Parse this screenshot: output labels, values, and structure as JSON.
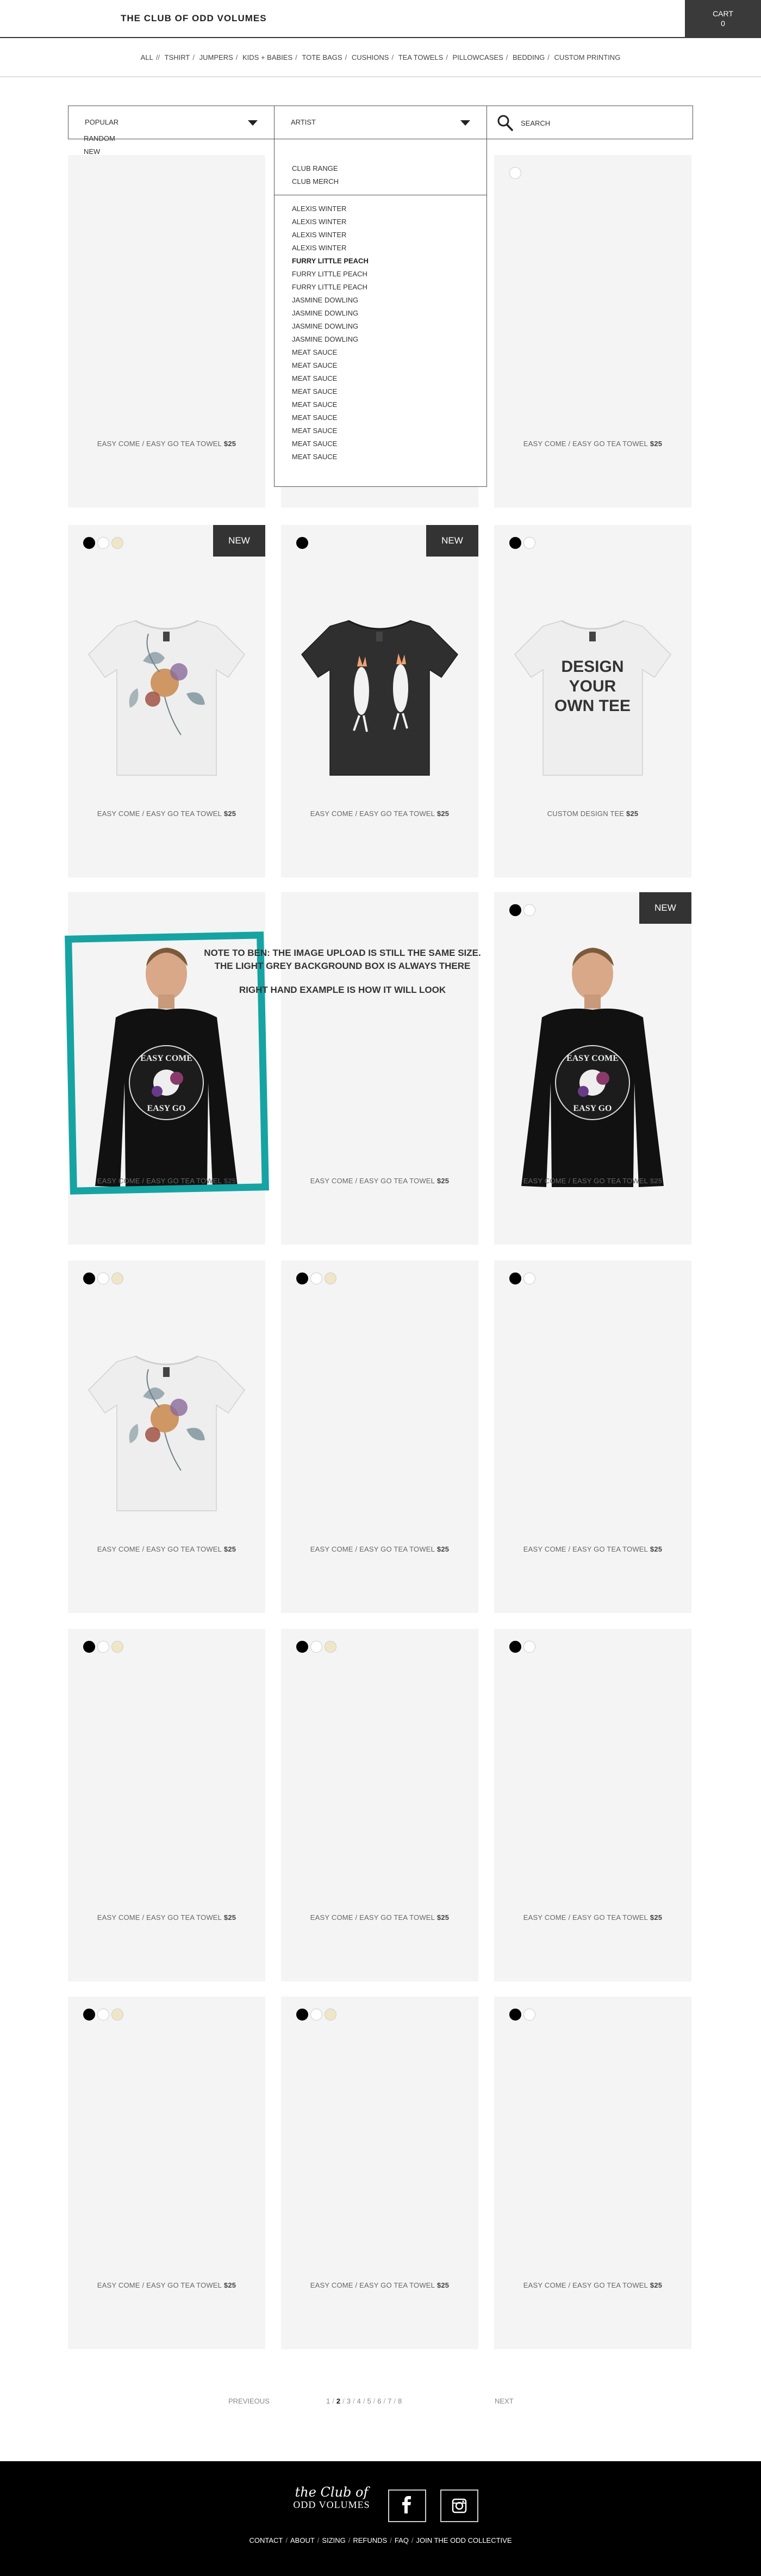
{
  "header": {
    "logo": "THE CLUB OF ODD VOLUMES",
    "cart_label": "CART",
    "cart_count": "0"
  },
  "nav": {
    "items": [
      "ALL",
      "TSHIRT",
      "JUMPERS",
      "KIDS + BABIES",
      "TOTE BAGS",
      "CUSHIONS",
      "TEA TOWELS",
      "PILLOWCASES",
      "BEDDING",
      "CUSTOM PRINTING"
    ],
    "separators": [
      "//",
      "/",
      "/",
      "/",
      "/",
      "/",
      "/",
      "/",
      "/"
    ]
  },
  "filters": {
    "sort": {
      "selected": "POPULAR",
      "options": [
        "RANDOM",
        "NEW"
      ]
    },
    "artist": {
      "selected": "ARTIST",
      "groups": [
        "CLUB RANGE",
        "CLUB MERCH"
      ],
      "artists": [
        "ALEXIS WINTER",
        "ALEXIS WINTER",
        "ALEXIS WINTER",
        "ALEXIS WINTER",
        "FURRY LITTLE PEACH",
        "FURRY LITTLE PEACH",
        "FURRY LITTLE PEACH",
        "JASMINE DOWLING",
        "JASMINE DOWLING",
        "JASMINE DOWLING",
        "JASMINE DOWLING",
        "MEAT SAUCE",
        "MEAT SAUCE",
        "MEAT SAUCE",
        "MEAT SAUCE",
        "MEAT SAUCE",
        "MEAT SAUCE",
        "MEAT SAUCE",
        "MEAT SAUCE",
        "MEAT SAUCE"
      ],
      "active": "FURRY LITTLE PEACH"
    },
    "search": {
      "placeholder": "SEARCH"
    }
  },
  "colors": {
    "black": "#000000",
    "white": "#ffffff",
    "cream": "#efe6c8",
    "card_bg": "#f4f4f4",
    "badge_bg": "#333333",
    "teal": "#16a3a3",
    "cart_bg": "#3a3a3a",
    "tee_white": "#eeeeee",
    "tee_black": "#2f2f2f"
  },
  "products": [
    {
      "name": "EASY COME / EASY GO TEA TOWEL",
      "price": "$25",
      "swatches": [],
      "badge": "",
      "image": ""
    },
    {
      "name": "",
      "price": "",
      "swatches": [],
      "badge": "",
      "image": ""
    },
    {
      "name": "EASY COME / EASY GO TEA TOWEL",
      "price": "$25",
      "swatches": [
        "white"
      ],
      "badge": "",
      "image": ""
    },
    {
      "name": "EASY COME / EASY GO TEA TOWEL",
      "price": "$25",
      "swatches": [
        "black",
        "white",
        "cream"
      ],
      "badge": "NEW",
      "image": "white-floral-tee"
    },
    {
      "name": "EASY COME / EASY GO TEA TOWEL",
      "price": "$25",
      "swatches": [
        "black"
      ],
      "badge": "NEW",
      "image": "black-cockatoo-tee"
    },
    {
      "name": "CUSTOM DESIGN TEE",
      "price": "$25",
      "swatches": [
        "black",
        "white"
      ],
      "badge": "",
      "image": "design-your-own-tee",
      "image_text": [
        "DESIGN",
        "YOUR",
        "OWN TEE"
      ]
    },
    {
      "name": "EASY COME / EASY GO TEA TOWEL",
      "price": "$25",
      "swatches": [],
      "badge": "",
      "image": "model-black-sweater"
    },
    {
      "name": "EASY COME / EASY GO TEA TOWEL",
      "price": "$25",
      "swatches": [],
      "badge": "",
      "image": ""
    },
    {
      "name": "EASY COME / EASY GO TEA TOWEL",
      "price": "$25",
      "swatches": [
        "black",
        "white"
      ],
      "badge": "NEW",
      "image": "model-black-sweater"
    },
    {
      "name": "EASY COME / EASY GO TEA TOWEL",
      "price": "$25",
      "swatches": [
        "black",
        "white",
        "cream"
      ],
      "badge": "",
      "image": "white-floral-tee"
    },
    {
      "name": "EASY COME / EASY GO TEA TOWEL",
      "price": "$25",
      "swatches": [
        "black",
        "white",
        "cream"
      ],
      "badge": "",
      "image": ""
    },
    {
      "name": "EASY COME / EASY GO TEA TOWEL",
      "price": "$25",
      "swatches": [
        "black",
        "white"
      ],
      "badge": "",
      "image": ""
    },
    {
      "name": "EASY COME / EASY GO TEA TOWEL",
      "price": "$25",
      "swatches": [
        "black",
        "white",
        "cream"
      ],
      "badge": "",
      "image": ""
    },
    {
      "name": "EASY COME / EASY GO TEA TOWEL",
      "price": "$25",
      "swatches": [
        "black",
        "white",
        "cream"
      ],
      "badge": "",
      "image": ""
    },
    {
      "name": "EASY COME / EASY GO TEA TOWEL",
      "price": "$25",
      "swatches": [
        "black",
        "white"
      ],
      "badge": "",
      "image": ""
    },
    {
      "name": "EASY COME / EASY GO TEA TOWEL",
      "price": "$25",
      "swatches": [
        "black",
        "white",
        "cream"
      ],
      "badge": "",
      "image": ""
    },
    {
      "name": "EASY COME / EASY GO TEA TOWEL",
      "price": "$25",
      "swatches": [
        "black",
        "white",
        "cream"
      ],
      "badge": "",
      "image": ""
    },
    {
      "name": "EASY COME / EASY GO TEA TOWEL",
      "price": "$25",
      "swatches": [
        "black",
        "white"
      ],
      "badge": "",
      "image": ""
    }
  ],
  "sweater_print": [
    "EASY COME",
    "EASY GO"
  ],
  "note": {
    "line1": "NOTE TO BEN: THE IMAGE UPLOAD IS STILL THE SAME SIZE.",
    "line2": "THE LIGHT GREY BACKGROUND BOX IS ALWAYS THERE",
    "line3": "RIGHT HAND EXAMPLE IS HOW IT WILL LOOK"
  },
  "pagination": {
    "prev": "PREVIEOUS",
    "next": "NEXT",
    "pages": [
      "1",
      "2",
      "3",
      "4",
      "5",
      "6",
      "7",
      "8"
    ],
    "current": "2"
  },
  "footer": {
    "logo_script": "the Club of",
    "logo_main": "ODD VOLUMES",
    "social": [
      "facebook-icon",
      "instagram-icon"
    ],
    "links": [
      "CONTACT",
      "ABOUT",
      "SIZING",
      "REFUNDS",
      "FAQ",
      "JOIN THE ODD COLLECTIVE"
    ]
  }
}
